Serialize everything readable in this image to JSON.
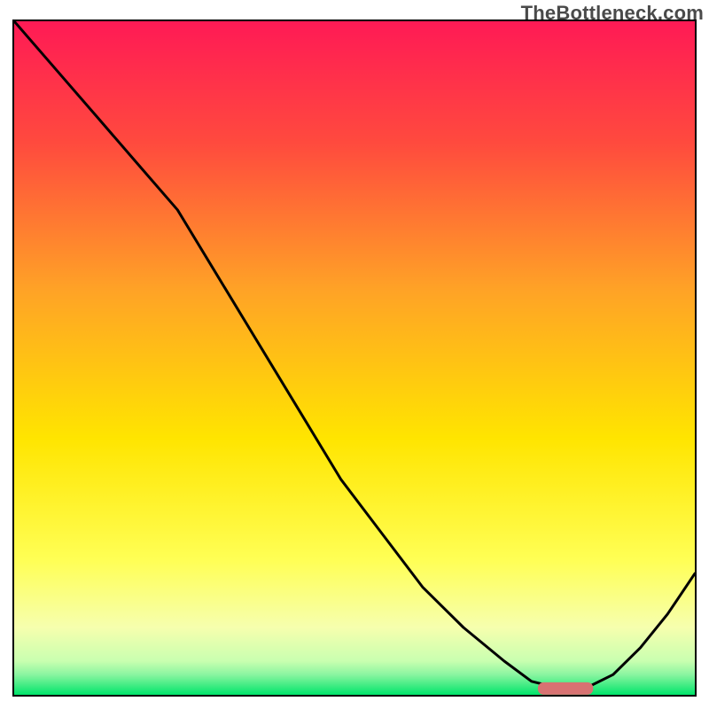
{
  "watermark": "TheBottleneck.com",
  "colors": {
    "gradient_top": "#ff1a55",
    "gradient_mid_top": "#ff7a2a",
    "gradient_mid": "#ffd300",
    "gradient_lower": "#ffff8a",
    "gradient_pale": "#f0ffd0",
    "gradient_bottom": "#00e46a",
    "curve_stroke": "#000000",
    "marker_fill": "#d87272",
    "marker_stroke": "#d87272",
    "border": "#000000"
  },
  "chart_data": {
    "type": "line",
    "title": "",
    "xlabel": "",
    "ylabel": "",
    "xlim": [
      0,
      100
    ],
    "ylim": [
      0,
      100
    ],
    "series": [
      {
        "name": "bottleneck-curve",
        "x": [
          0,
          6,
          12,
          18,
          24,
          30,
          36,
          42,
          48,
          54,
          60,
          66,
          72,
          76,
          80,
          84,
          88,
          92,
          96,
          100
        ],
        "y": [
          100,
          93,
          86,
          79,
          72,
          62,
          52,
          42,
          32,
          24,
          16,
          10,
          5,
          2,
          1,
          1,
          3,
          7,
          12,
          18
        ]
      }
    ],
    "markers": [
      {
        "name": "optimal-range",
        "x_start": 77,
        "x_end": 85,
        "y": 1
      }
    ],
    "annotations": []
  }
}
